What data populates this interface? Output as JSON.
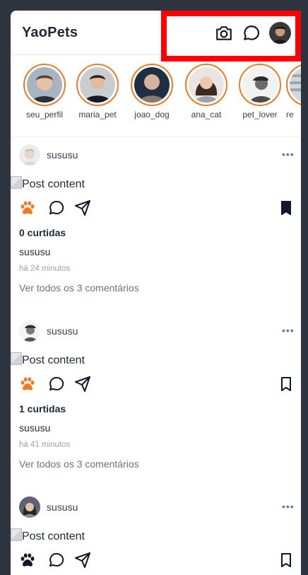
{
  "app": {
    "title": "YaoPets"
  },
  "header": {
    "icons": [
      "camera-icon",
      "chat-bubble-icon",
      "profile-avatar"
    ]
  },
  "stories": [
    {
      "username": "seu_perfil"
    },
    {
      "username": "maria_pet"
    },
    {
      "username": "joao_dog"
    },
    {
      "username": "ana_cat"
    },
    {
      "username": "pet_lover"
    },
    {
      "username": "re"
    }
  ],
  "posts": [
    {
      "username": "sususu",
      "image_alt": "Post content",
      "likes": "0 curtidas",
      "caption": "sususu",
      "time": "há 24 minutos",
      "comments": "Ver todos os 3 comentários",
      "liked": true,
      "saved": true
    },
    {
      "username": "sususu",
      "image_alt": "Post content",
      "likes": "1 curtidas",
      "caption": "sususu",
      "time": "há 41 minutos",
      "comments": "Ver todos os 3 comentários",
      "liked": true,
      "saved": false
    },
    {
      "username": "sususu",
      "image_alt": "Post content",
      "likes": "",
      "caption": "",
      "time": "",
      "comments": "",
      "liked": false,
      "saved": false
    }
  ],
  "colors": {
    "accent": "#f07b22",
    "background": "#2e3440",
    "highlight": "#ff0000",
    "text": "#1f2937"
  }
}
